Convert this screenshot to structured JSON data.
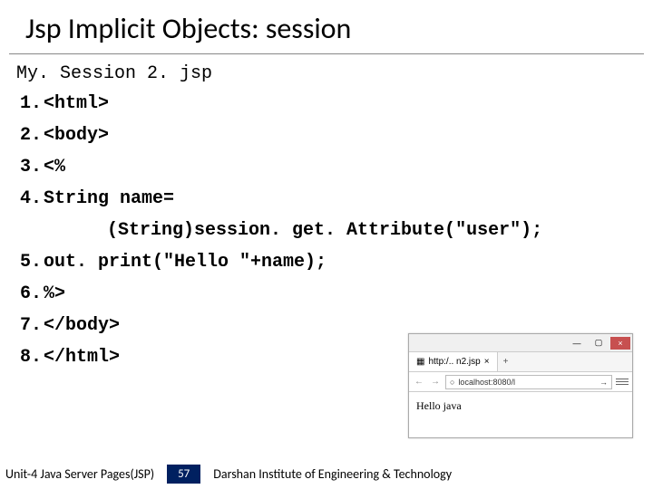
{
  "title": "Jsp Implicit Objects: session",
  "filename": "My. Session 2. jsp",
  "code": [
    {
      "n": "1.",
      "t": "<html>"
    },
    {
      "n": "2.",
      "t": "<body>"
    },
    {
      "n": "3.",
      "t": "<%"
    },
    {
      "n": "4.",
      "t": "String name="
    },
    {
      "n": "",
      "t": "(String)session. get. Attribute(\"user\");",
      "indent": true
    },
    {
      "n": "5.",
      "t": "out. print(\"Hello \"+name);"
    },
    {
      "n": "6.",
      "t": "%>"
    },
    {
      "n": "7.",
      "t": "</body>"
    },
    {
      "n": "8.",
      "t": "</html>"
    }
  ],
  "browser": {
    "tab_label": "http:/.. n2.jsp",
    "tab_plus": "+",
    "nav_back": "←",
    "nav_fwd": "→",
    "url": "localhost:8080/l",
    "action_glyph": "→",
    "min": "—",
    "max": "▢",
    "close": "×",
    "page_text": "Hello java"
  },
  "footer": {
    "left": "Unit-4 Java Server Pages(JSP)",
    "page": "57",
    "right": "Darshan Institute of Engineering & Technology"
  }
}
